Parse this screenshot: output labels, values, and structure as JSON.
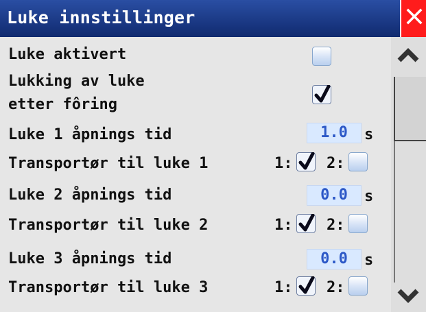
{
  "window": {
    "title": "Luke innstillinger",
    "close_glyph": "close-icon"
  },
  "settings": [
    {
      "key": "luke_aktivert",
      "label": "Luke aktivert",
      "type": "checkbox",
      "checked": false
    },
    {
      "key": "lukking",
      "label_line1": "Lukking av luke",
      "label_line2": "etter fôring",
      "type": "checkbox",
      "checked": true
    },
    {
      "key": "luke1_tid",
      "label": "Luke 1 åpnings tid",
      "type": "number",
      "value": "1.0",
      "unit": "s"
    },
    {
      "key": "transport1",
      "label": "Transportør til luke 1",
      "type": "dual-checkbox",
      "a_label": "1:",
      "a_checked": true,
      "b_label": "2:",
      "b_checked": false
    },
    {
      "key": "luke2_tid",
      "label": "Luke 2 åpnings tid",
      "type": "number",
      "value": "0.0",
      "unit": "s"
    },
    {
      "key": "transport2",
      "label": "Transportør til luke 2",
      "type": "dual-checkbox",
      "a_label": "1:",
      "a_checked": true,
      "b_label": "2:",
      "b_checked": false
    },
    {
      "key": "luke3_tid",
      "label": "Luke 3 åpnings tid",
      "type": "number",
      "value": "0.0",
      "unit": "s"
    },
    {
      "key": "transport3",
      "label": "Transportør til luke 3",
      "type": "dual-checkbox",
      "a_label": "1:",
      "a_checked": true,
      "b_label": "2:",
      "b_checked": false
    }
  ],
  "colors": {
    "titlebar": "#1b3a8a",
    "close": "#ff1c1c",
    "input_bg": "#d9e9ff",
    "input_text": "#2c58c7",
    "background": "#e6e6e6"
  }
}
